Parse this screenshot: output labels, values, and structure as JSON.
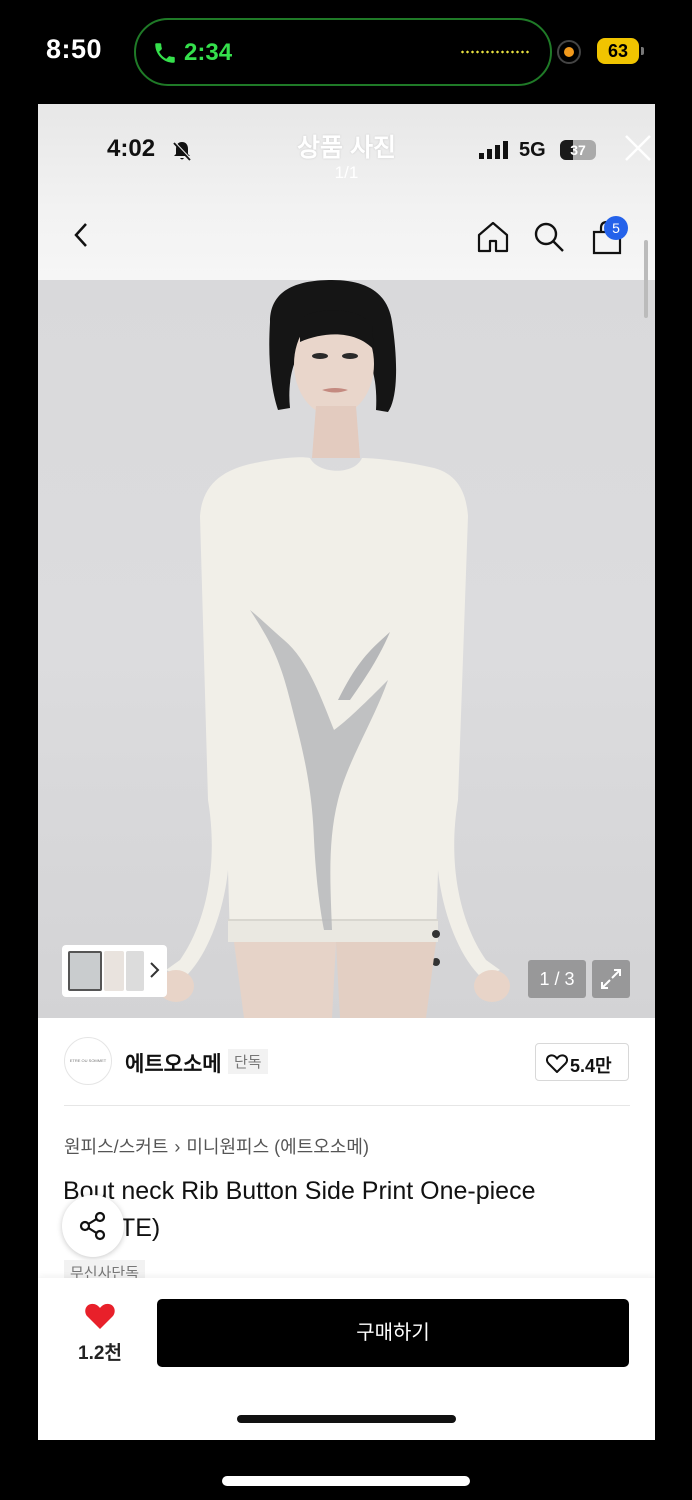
{
  "outer_status": {
    "time": "8:50",
    "call_duration": "2:34",
    "battery": "63"
  },
  "inner_status": {
    "time": "4:02",
    "network": "5G",
    "battery": "37"
  },
  "viewer": {
    "title": "상품 사진",
    "count": "1/1"
  },
  "header": {
    "cart_badge": "5"
  },
  "gallery": {
    "counter": "1 / 3"
  },
  "brand": {
    "logo_text": "ETRE OU SOMMET",
    "name": "에트오소메",
    "exclusive_tag": "단독",
    "likes": "5.4만"
  },
  "product": {
    "breadcrumb": [
      "원피스/스커트",
      "미니원피스 (에트오소메)"
    ],
    "title": "Bout neck Rib Button Side Print One-piece (WHITE)",
    "tag": "무신사단독"
  },
  "bottom_bar": {
    "fav_count": "1.2천",
    "buy_label": "구매하기"
  },
  "colors": {
    "call_green": "#35e04c",
    "badge_blue": "#2462ea",
    "heart_red": "#e8202a",
    "buy_black": "#000000"
  }
}
